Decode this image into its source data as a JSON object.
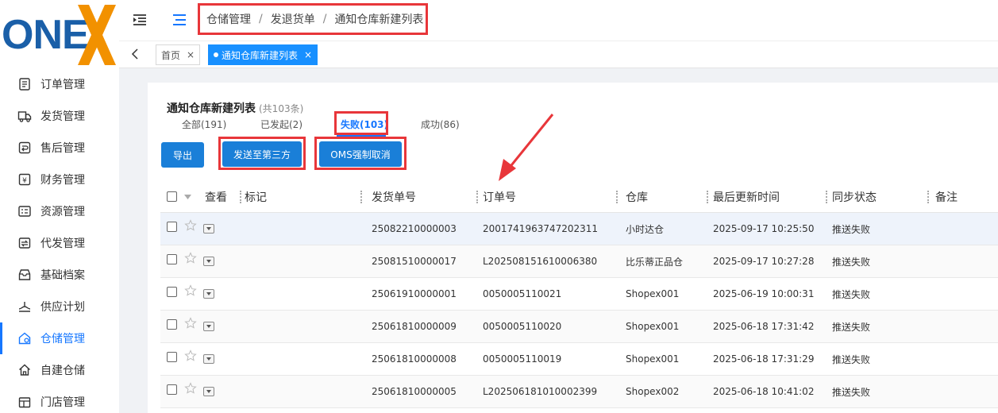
{
  "logo": {
    "text": "ONE",
    "accent_color": "#f29100",
    "brand_color": "#1a5fa8"
  },
  "sidebar": {
    "items": [
      {
        "label": "订单管理",
        "icon": "order-icon"
      },
      {
        "label": "发货管理",
        "icon": "truck-icon"
      },
      {
        "label": "售后管理",
        "icon": "after-sale-icon"
      },
      {
        "label": "财务管理",
        "icon": "finance-icon"
      },
      {
        "label": "资源管理",
        "icon": "resource-icon"
      },
      {
        "label": "代发管理",
        "icon": "dropship-icon"
      },
      {
        "label": "基础档案",
        "icon": "archive-icon"
      },
      {
        "label": "供应计划",
        "icon": "supply-icon"
      },
      {
        "label": "仓储管理",
        "icon": "warehouse-icon",
        "active": true
      },
      {
        "label": "自建仓储",
        "icon": "home-icon"
      },
      {
        "label": "门店管理",
        "icon": "store-icon"
      }
    ]
  },
  "breadcrumb": {
    "items": [
      "仓储管理",
      "发退货单",
      "通知仓库新建列表"
    ],
    "separator": "/"
  },
  "tabbar": {
    "tags": [
      {
        "label": "首页",
        "close": "×",
        "active": false
      },
      {
        "label": "通知仓库新建列表",
        "close": "×",
        "active": true
      }
    ]
  },
  "page": {
    "title": "通知仓库新建列表",
    "count": "(共103条)",
    "tabs": [
      {
        "label": "全部(191)"
      },
      {
        "label": "已发起(2)"
      },
      {
        "label": "失败(103)",
        "active": true
      },
      {
        "label": "成功(86)"
      }
    ],
    "buttons": {
      "export": "导出",
      "send_third": "发送至第三方",
      "oms_cancel": "OMS强制取消"
    }
  },
  "table": {
    "columns": [
      "查看",
      "标记",
      "发货单号",
      "订单号",
      "仓库",
      "最后更新时间",
      "同步状态",
      "备注"
    ],
    "rows": [
      {
        "ship_no": "25082210000003",
        "order_no": "2001741963747202311",
        "warehouse": "小时达仓",
        "updated": "2025-09-17 10:25:50",
        "status": "推送失败"
      },
      {
        "ship_no": "25081510000017",
        "order_no": "L202508151610006380",
        "warehouse": "比乐蒂正品仓",
        "updated": "2025-09-17 10:27:28",
        "status": "推送失败"
      },
      {
        "ship_no": "25061910000001",
        "order_no": "0050005110021",
        "warehouse": "Shopex001",
        "updated": "2025-06-19 10:00:31",
        "status": "推送失败"
      },
      {
        "ship_no": "25061810000009",
        "order_no": "0050005110020",
        "warehouse": "Shopex001",
        "updated": "2025-06-18 17:31:42",
        "status": "推送失败"
      },
      {
        "ship_no": "25061810000008",
        "order_no": "0050005110019",
        "warehouse": "Shopex001",
        "updated": "2025-06-18 17:31:29",
        "status": "推送失败"
      },
      {
        "ship_no": "25061810000005",
        "order_no": "L202506181010002399",
        "warehouse": "Shopex002",
        "updated": "2025-06-18 10:41:02",
        "status": "推送失败"
      }
    ]
  },
  "colors": {
    "primary": "#1677ff",
    "button": "#1a7fd8",
    "annotation": "#e8363a"
  }
}
